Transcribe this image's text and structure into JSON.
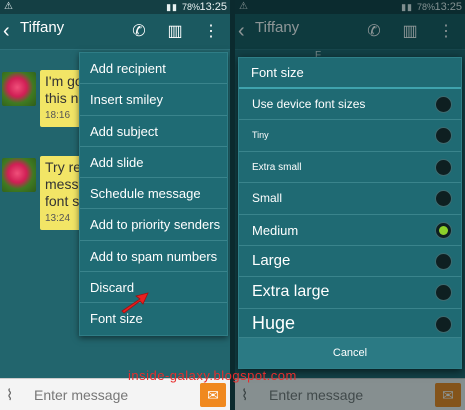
{
  "status": {
    "battery_pct": "78%",
    "time": "13:25"
  },
  "conversation": {
    "contact_name": "Tiffany",
    "partial_date": "F",
    "messages": [
      {
        "line1": "I'm go",
        "line2": "this ni",
        "time": "18:16"
      },
      {
        "line1": "Try re",
        "line2": "messa",
        "line3": "font s",
        "time": "13:24"
      }
    ]
  },
  "overflow_menu": {
    "items": [
      "Add recipient",
      "Insert smiley",
      "Add subject",
      "Add slide",
      "Schedule message",
      "Add to priority senders",
      "Add to spam numbers",
      "Discard",
      "Font size"
    ]
  },
  "font_size_dialog": {
    "title": "Font size",
    "options": [
      {
        "label": "Use device font sizes",
        "selected": false
      },
      {
        "label": "Tiny",
        "selected": false
      },
      {
        "label": "Extra small",
        "selected": false
      },
      {
        "label": "Small",
        "selected": false
      },
      {
        "label": "Medium",
        "selected": true
      },
      {
        "label": "Large",
        "selected": false
      },
      {
        "label": "Extra large",
        "selected": false
      },
      {
        "label": "Huge",
        "selected": false
      }
    ],
    "cancel_label": "Cancel"
  },
  "composer": {
    "placeholder": "Enter message"
  },
  "watermark": "inside-galaxy.blogspot.com",
  "icons": {
    "back": "chevron-left-icon",
    "call": "phone-icon",
    "delete": "trash-icon",
    "more": "more-vertical-icon",
    "attach": "paperclip-icon",
    "send": "envelope-icon",
    "pointer": "red-arrow-icon"
  },
  "colors": {
    "accent_select": "#8cd12a",
    "send_button": "#f0891f",
    "bubble": "#f2e566",
    "watermark": "#e82d2d"
  }
}
